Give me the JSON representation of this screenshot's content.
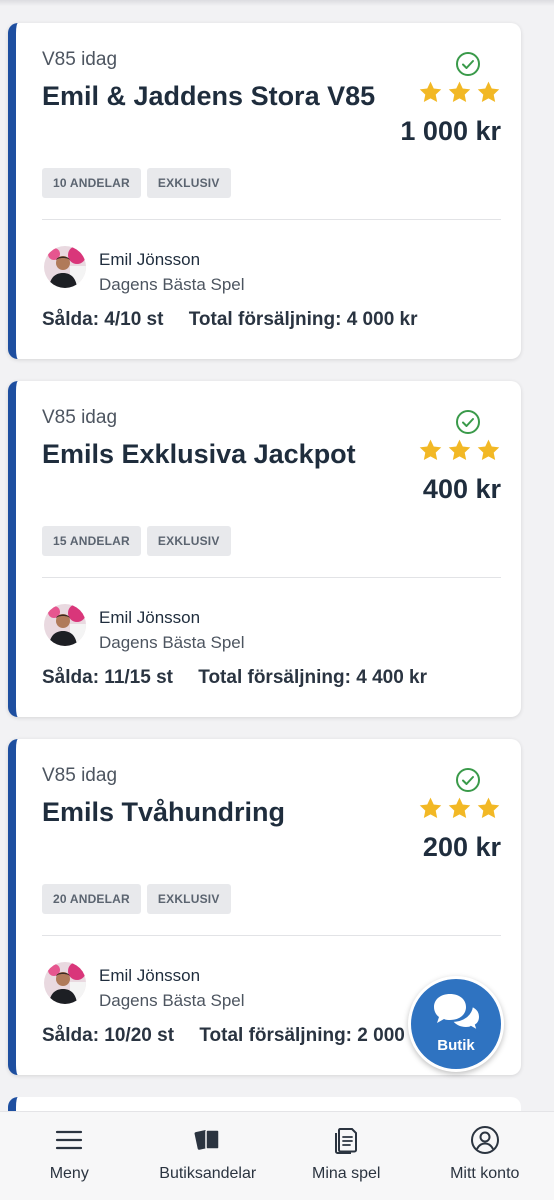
{
  "cards": [
    {
      "subtitle": "V85 idag",
      "title": "Emil & Jaddens Stora V85",
      "price": "1 000 kr",
      "stars": 3,
      "tags": [
        "10 ANDELAR",
        "EXKLUSIV"
      ],
      "author_name": "Emil Jönsson",
      "author_sub": "Dagens Bästa Spel",
      "sold": "Sålda: 4/10 st",
      "total": "Total försäljning: 4 000 kr"
    },
    {
      "subtitle": "V85 idag",
      "title": "Emils Exklusiva Jackpot",
      "price": "400 kr",
      "stars": 3,
      "tags": [
        "15 ANDELAR",
        "EXKLUSIV"
      ],
      "author_name": "Emil Jönsson",
      "author_sub": "Dagens Bästa Spel",
      "sold": "Sålda: 11/15 st",
      "total": "Total försäljning: 4 400 kr"
    },
    {
      "subtitle": "V85 idag",
      "title": "Emils Tvåhundring",
      "price": "200 kr",
      "stars": 3,
      "tags": [
        "20 ANDELAR",
        "EXKLUSIV"
      ],
      "author_name": "Emil Jönsson",
      "author_sub": "Dagens Bästa Spel",
      "sold": "Sålda: 10/20 st",
      "total": "Total försäljning: 2 000"
    }
  ],
  "fab": {
    "label": "Butik",
    "icon": "chat-bubbles-icon"
  },
  "bottom_nav": [
    {
      "label": "Meny",
      "icon": "menu-icon"
    },
    {
      "label": "Butiksandelar",
      "icon": "cards-icon"
    },
    {
      "label": "Mina spel",
      "icon": "document-icon"
    },
    {
      "label": "Mitt konto",
      "icon": "account-icon"
    }
  ],
  "colors": {
    "accent": "#1e4fa0",
    "star": "#f2b825",
    "check": "#3a9a4a",
    "fab": "#2f73c1"
  }
}
